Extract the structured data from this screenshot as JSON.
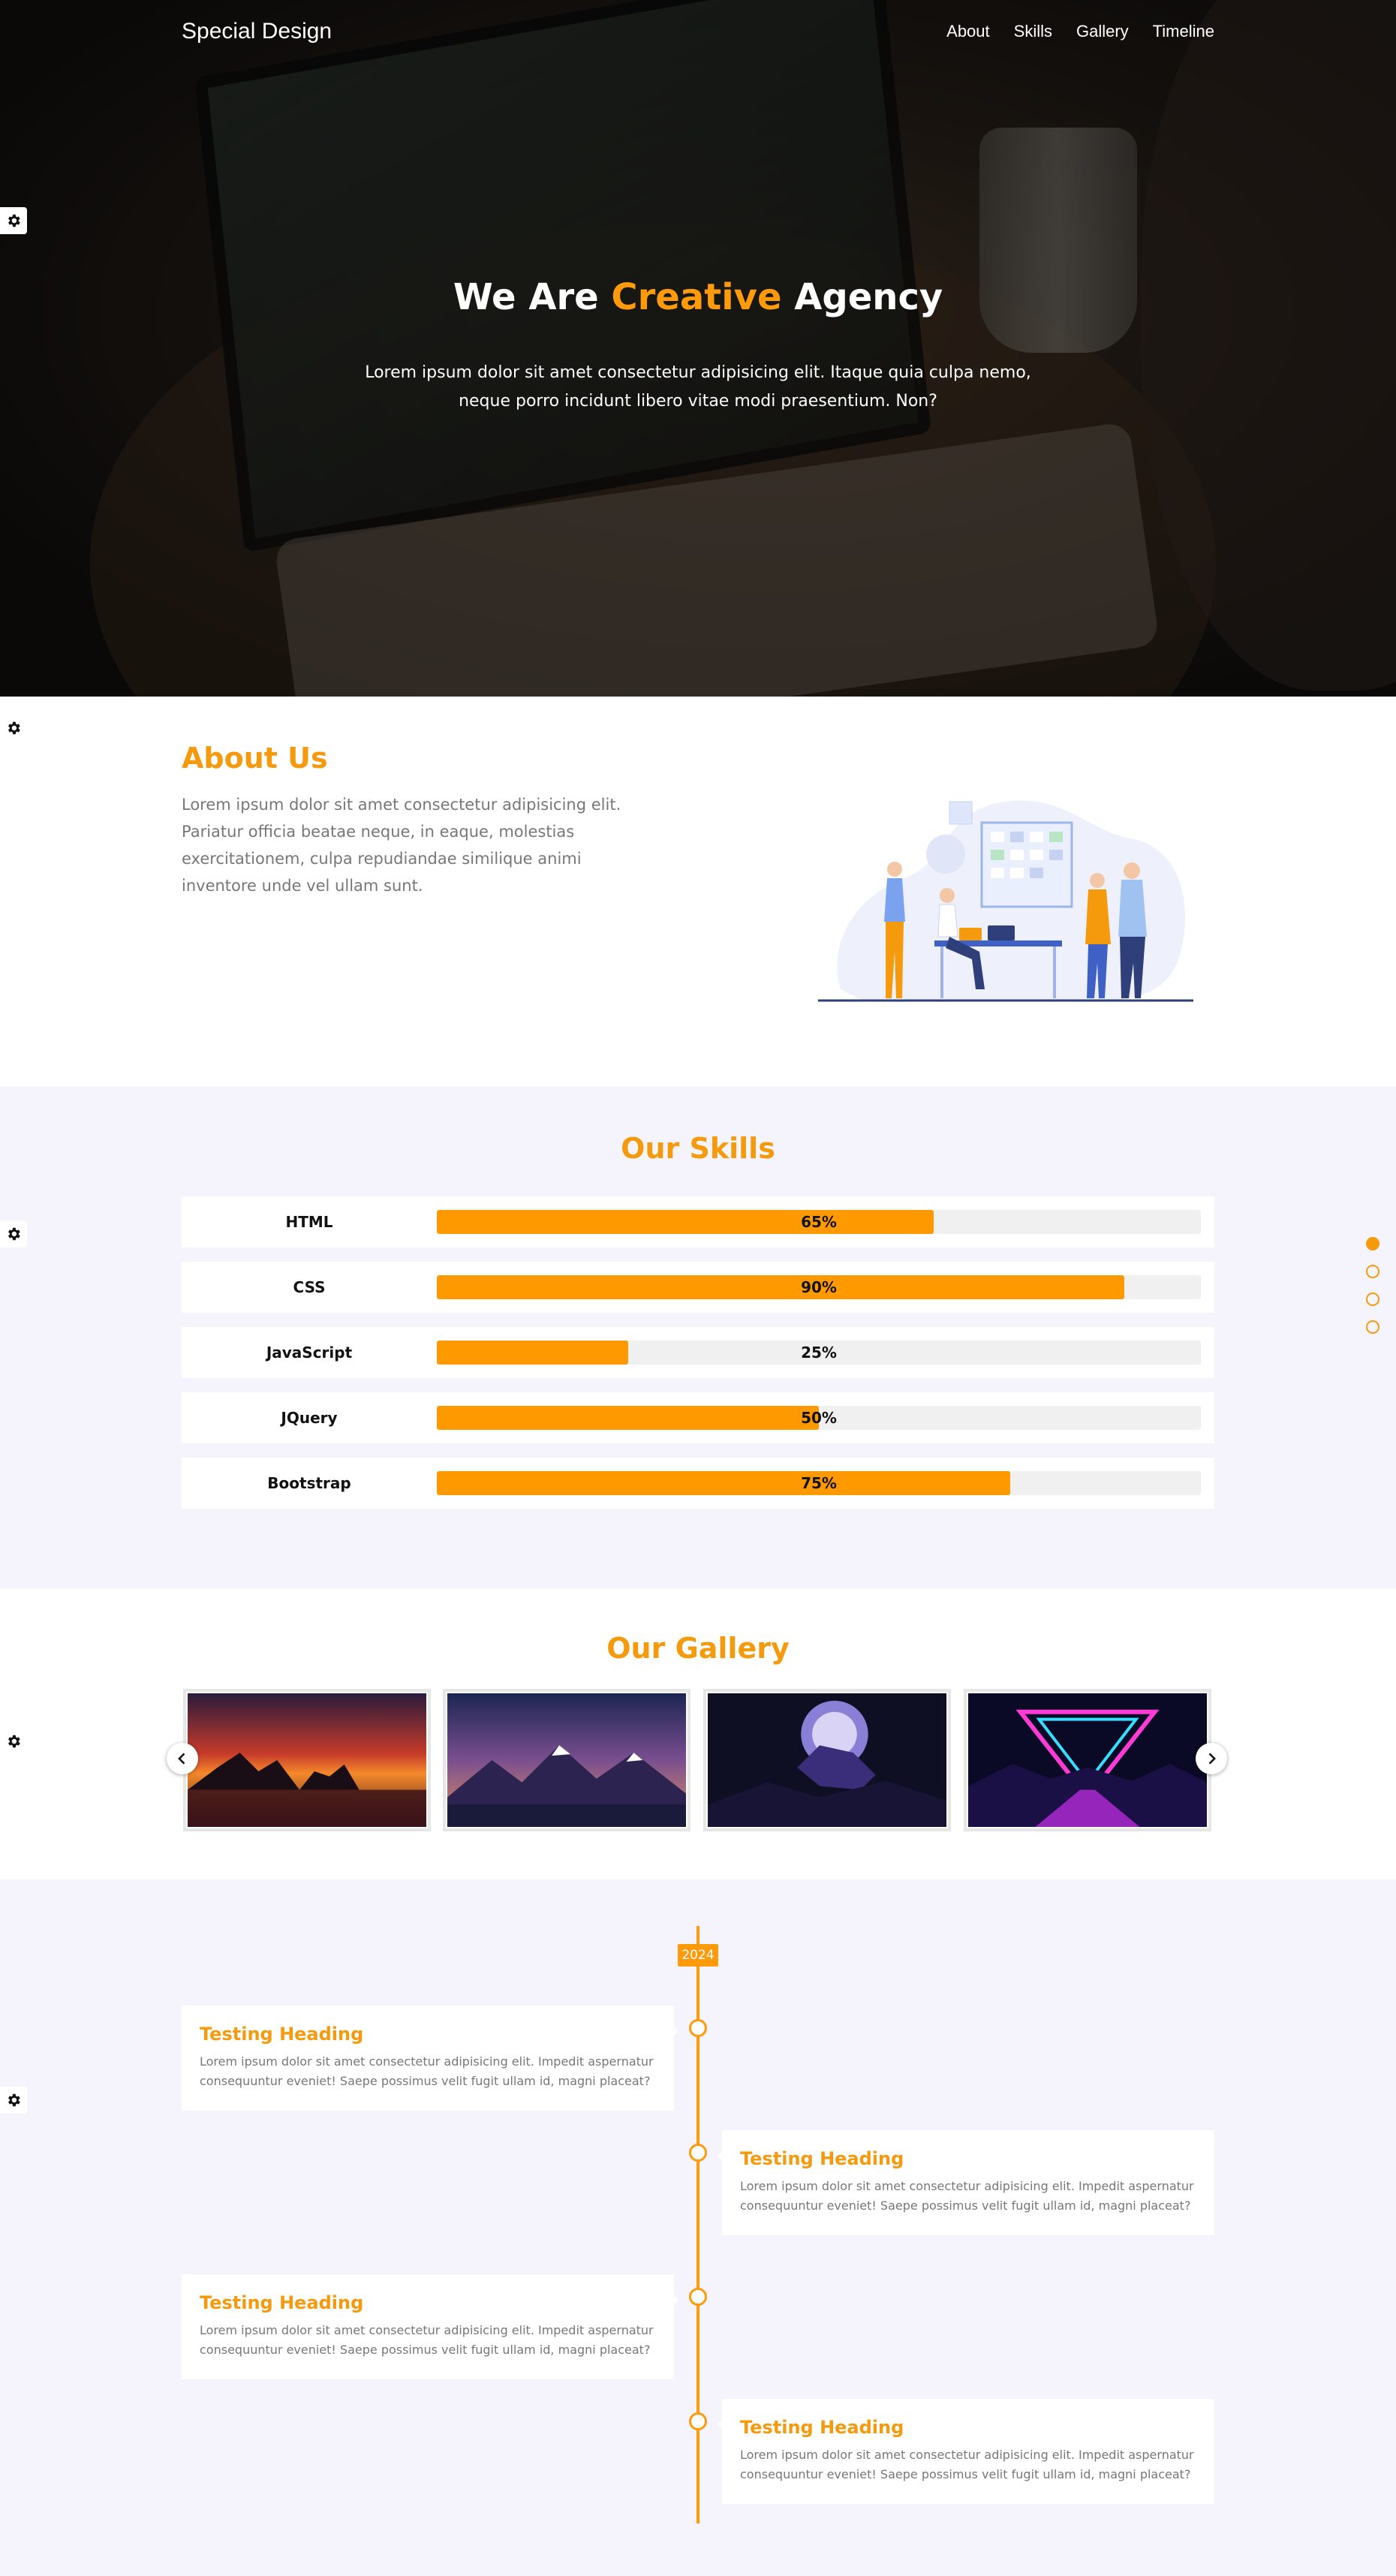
{
  "nav": {
    "brand": "Special Design",
    "links": [
      "About",
      "Skills",
      "Gallery",
      "Timeline"
    ]
  },
  "hero": {
    "title_before": "We Are ",
    "title_accent": "Creative",
    "title_after": " Agency",
    "subtitle": "Lorem ipsum dolor sit amet consectetur adipisicing elit. Itaque quia culpa nemo, neque porro incidunt libero vitae modi praesentium. Non?"
  },
  "about": {
    "title": "About Us",
    "text": "Lorem ipsum dolor sit amet consectetur adipisicing elit. Pariatur officia beatae neque, in eaque, molestias exercitationem, culpa repudiandae similique animi inventore unde vel ullam sunt."
  },
  "skills": {
    "title": "Our Skills",
    "items": [
      {
        "name": "HTML",
        "percent": 65,
        "label": "65%"
      },
      {
        "name": "CSS",
        "percent": 90,
        "label": "90%"
      },
      {
        "name": "JavaScript",
        "percent": 25,
        "label": "25%"
      },
      {
        "name": "JQuery",
        "percent": 50,
        "label": "50%"
      },
      {
        "name": "Bootstrap",
        "percent": 75,
        "label": "75%"
      }
    ]
  },
  "gallery": {
    "title": "Our Gallery"
  },
  "timeline": {
    "year": "2024",
    "entries": [
      {
        "heading": "Testing Heading",
        "text": "Lorem ipsum dolor sit amet consectetur adipisicing elit. Impedit aspernatur consequuntur eveniet! Saepe possimus velit fugit ullam id, magni placeat?"
      },
      {
        "heading": "Testing Heading",
        "text": "Lorem ipsum dolor sit amet consectetur adipisicing elit. Impedit aspernatur consequuntur eveniet! Saepe possimus velit fugit ullam id, magni placeat?"
      },
      {
        "heading": "Testing Heading",
        "text": "Lorem ipsum dolor sit amet consectetur adipisicing elit. Impedit aspernatur consequuntur eveniet! Saepe possimus velit fugit ullam id, magni placeat?"
      },
      {
        "heading": "Testing Heading",
        "text": "Lorem ipsum dolor sit amet consectetur adipisicing elit. Impedit aspernatur consequuntur eveniet! Saepe possimus velit fugit ullam id, magni placeat?"
      }
    ]
  },
  "colors": {
    "accent": "#ff9a0b",
    "section_bg": "#f5f4fd"
  },
  "icons": {
    "settings": "gear-icon",
    "prev": "chevron-left-icon",
    "next": "chevron-right-icon"
  }
}
